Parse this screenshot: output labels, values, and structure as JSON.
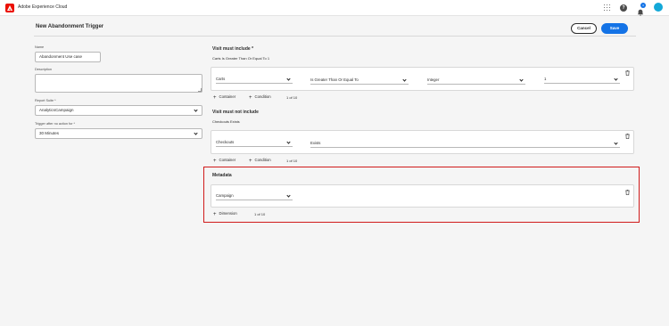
{
  "app": {
    "title": "Adobe Experience Cloud",
    "notification_count": "3"
  },
  "page": {
    "title": "New Abandonment Trigger",
    "cancel_label": "Cancel",
    "save_label": "Save"
  },
  "form": {
    "name_label": "Name",
    "name_value": "Abandonment Use case",
    "description_label": "Description",
    "description_value": "",
    "report_suite_label": "Report Suite *",
    "report_suite_value": "AnalyticsCampaign",
    "trigger_label": "Trigger after no action for *",
    "trigger_value": "30 Minutes"
  },
  "include": {
    "title": "Visit must include *",
    "summary": "Carts Is Greater Than Or Equal To 1",
    "dimension": "Carts",
    "operator": "Is Greater Than Or Equal To",
    "type": "Integer",
    "value": "1",
    "add_container": "Container",
    "add_condition": "Condition",
    "count": "1 of 10"
  },
  "exclude": {
    "title": "Visit must not include",
    "summary": "Checkouts Exists",
    "dimension": "Checkouts",
    "operator": "Exists",
    "add_container": "Container",
    "add_condition": "Condition",
    "count": "1 of 10"
  },
  "metadata": {
    "title": "Metadata",
    "dimension": "Campaign",
    "add_dimension": "Dimension",
    "count": "1 of 10"
  },
  "colors": {
    "accent": "#1473e6",
    "highlight": "#d01a1a",
    "brand": "#eb1000"
  }
}
